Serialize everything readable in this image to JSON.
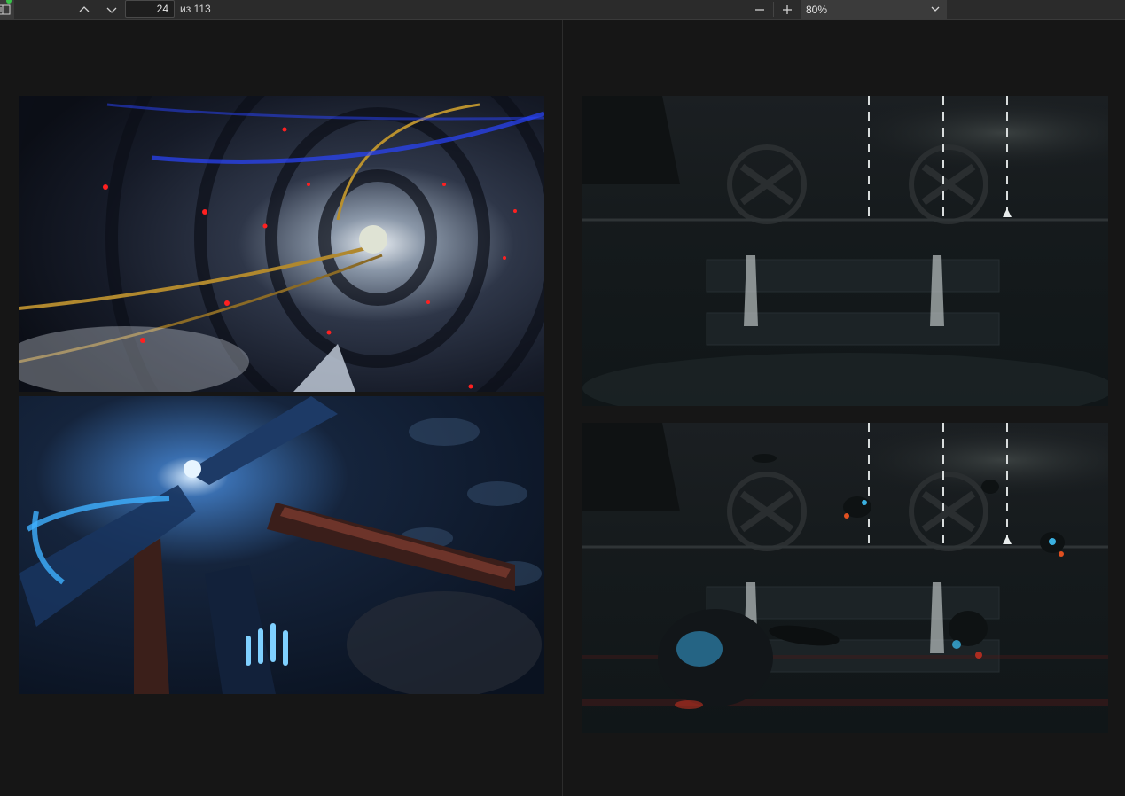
{
  "toolbar": {
    "sidebar_icon": "sidebar-icon",
    "prev_icon": "chevron-up-icon",
    "next_icon": "chevron-down-icon",
    "current_page": "24",
    "page_total": "из 113",
    "zoom_out_icon": "minus-icon",
    "zoom_in_icon": "plus-icon",
    "zoom_value": "80%",
    "zoom_caret_icon": "chevron-down-icon"
  },
  "pages": [
    {
      "id": "left-page",
      "images": [
        {
          "name": "tunnel-artwork",
          "description_icon": "image"
        },
        {
          "name": "pipe-corridor-artwork",
          "description_icon": "image"
        }
      ]
    },
    {
      "id": "right-page",
      "images": [
        {
          "name": "hangar-fans-artwork",
          "description_icon": "image"
        },
        {
          "name": "hangar-drones-artwork",
          "description_icon": "image"
        }
      ]
    }
  ],
  "colors": {
    "toolbar_bg": "#2b2b2b",
    "viewer_bg": "#161616",
    "zoom_bg": "#3b3b3b"
  }
}
